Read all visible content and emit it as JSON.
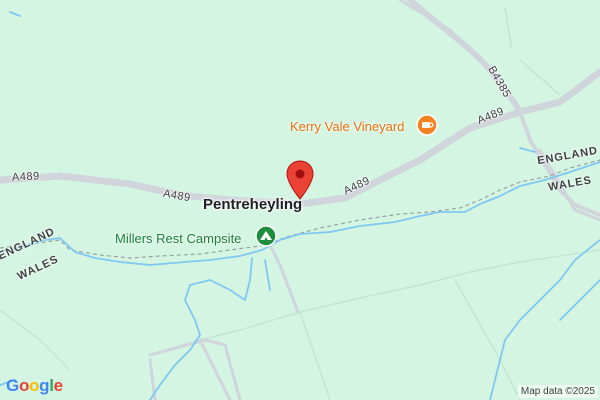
{
  "map": {
    "labels": {
      "place": "Pentreheyling",
      "campsite": "Millers Rest Campsite",
      "vineyard": "Kerry Vale Vineyard",
      "road_a489_left": "A489",
      "road_a489_mid": "A489",
      "road_a489_center": "A489",
      "road_a489_right": "A489",
      "road_b4385": "B4385",
      "border_england_left": "ENGLAND",
      "border_wales_left": "WALES",
      "border_england_right": "ENGLAND",
      "border_wales_right": "WALES"
    },
    "icons": {
      "pin": "location-pin-icon",
      "campsite": "campsite-tent-icon",
      "vineyard": "vineyard-cup-icon"
    },
    "colors": {
      "land": "#d4f5e2",
      "road": "#d0d4db",
      "water": "#7fc8f2",
      "pin": "#ea4335",
      "campsite_poi": "#188038",
      "vineyard_poi": "#e8710a"
    }
  },
  "branding": {
    "logo_letters": [
      "G",
      "o",
      "o",
      "g",
      "l",
      "e"
    ],
    "attribution": "Map data ©2025"
  }
}
